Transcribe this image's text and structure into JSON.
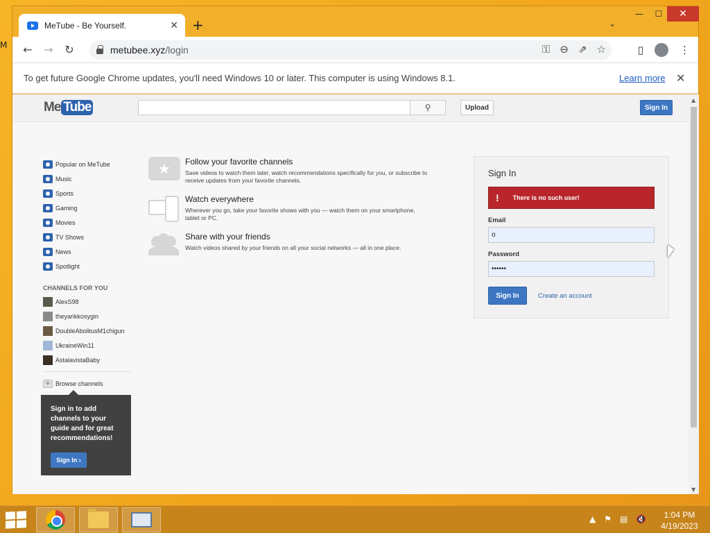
{
  "browser": {
    "tab_title": "MeTube - Be Yourself.",
    "tab_close": "✕",
    "new_tab": "+",
    "tab_search": "⌄",
    "win_min": "—",
    "win_max": "☐",
    "win_close": "✕",
    "back": "←",
    "forward": "→",
    "reload": "↻",
    "url_host": "metubee.xyz",
    "url_path": "/login",
    "menu": "⋮"
  },
  "infobar": {
    "message": "To get future Google Chrome updates, you'll need Windows 10 or later. This computer is using Windows 8.1.",
    "link": "Learn more",
    "close": "✕"
  },
  "header": {
    "logo_me": "Me",
    "logo_tube": "Tube",
    "search_value": "",
    "upload": "Upload",
    "sign_in": "Sign In"
  },
  "guide": {
    "items": [
      {
        "label": "Popular on MeTube",
        "icon": "popular-icon"
      },
      {
        "label": "Music",
        "icon": "music-icon"
      },
      {
        "label": "Sports",
        "icon": "sports-icon"
      },
      {
        "label": "Gaming",
        "icon": "gaming-icon"
      },
      {
        "label": "Movies",
        "icon": "movies-icon"
      },
      {
        "label": "TV Shows",
        "icon": "tv-icon"
      },
      {
        "label": "News",
        "icon": "news-icon"
      },
      {
        "label": "Spotlight",
        "icon": "spotlight-icon"
      }
    ],
    "channels_heading": "CHANNELS FOR YOU",
    "channels": [
      "AlexS98",
      "theyarikkosygin",
      "DoubleAbolitusM1chigun",
      "UkraineWin11",
      "AstalavistaBaby"
    ],
    "browse": "Browse channels"
  },
  "promo": {
    "text": "Sign in to add channels to your guide and for great recommendations!",
    "button": "Sign In ›"
  },
  "features": [
    {
      "title": "Follow your favorite channels",
      "desc": "Save videos to watch them later, watch recommendations specifically for you, or subscribe to receive updates from your favorite channels."
    },
    {
      "title": "Watch everywhere",
      "desc": "Wherever you go, take your favorite shows with you — watch them on your smartphone, tablet or PC."
    },
    {
      "title": "Share with your friends",
      "desc": "Watch videos shared by your friends on all your social networks — all in one place."
    }
  ],
  "signin": {
    "title": "Sign In",
    "error_icon": "!",
    "error": "There is no such user!",
    "email_label": "Email",
    "email_value": "o",
    "password_label": "Password",
    "password_value": "••••••",
    "button": "Sign In",
    "create_link": "Create an account"
  },
  "taskbar": {
    "time": "1:04 PM",
    "date": "4/19/2023"
  }
}
